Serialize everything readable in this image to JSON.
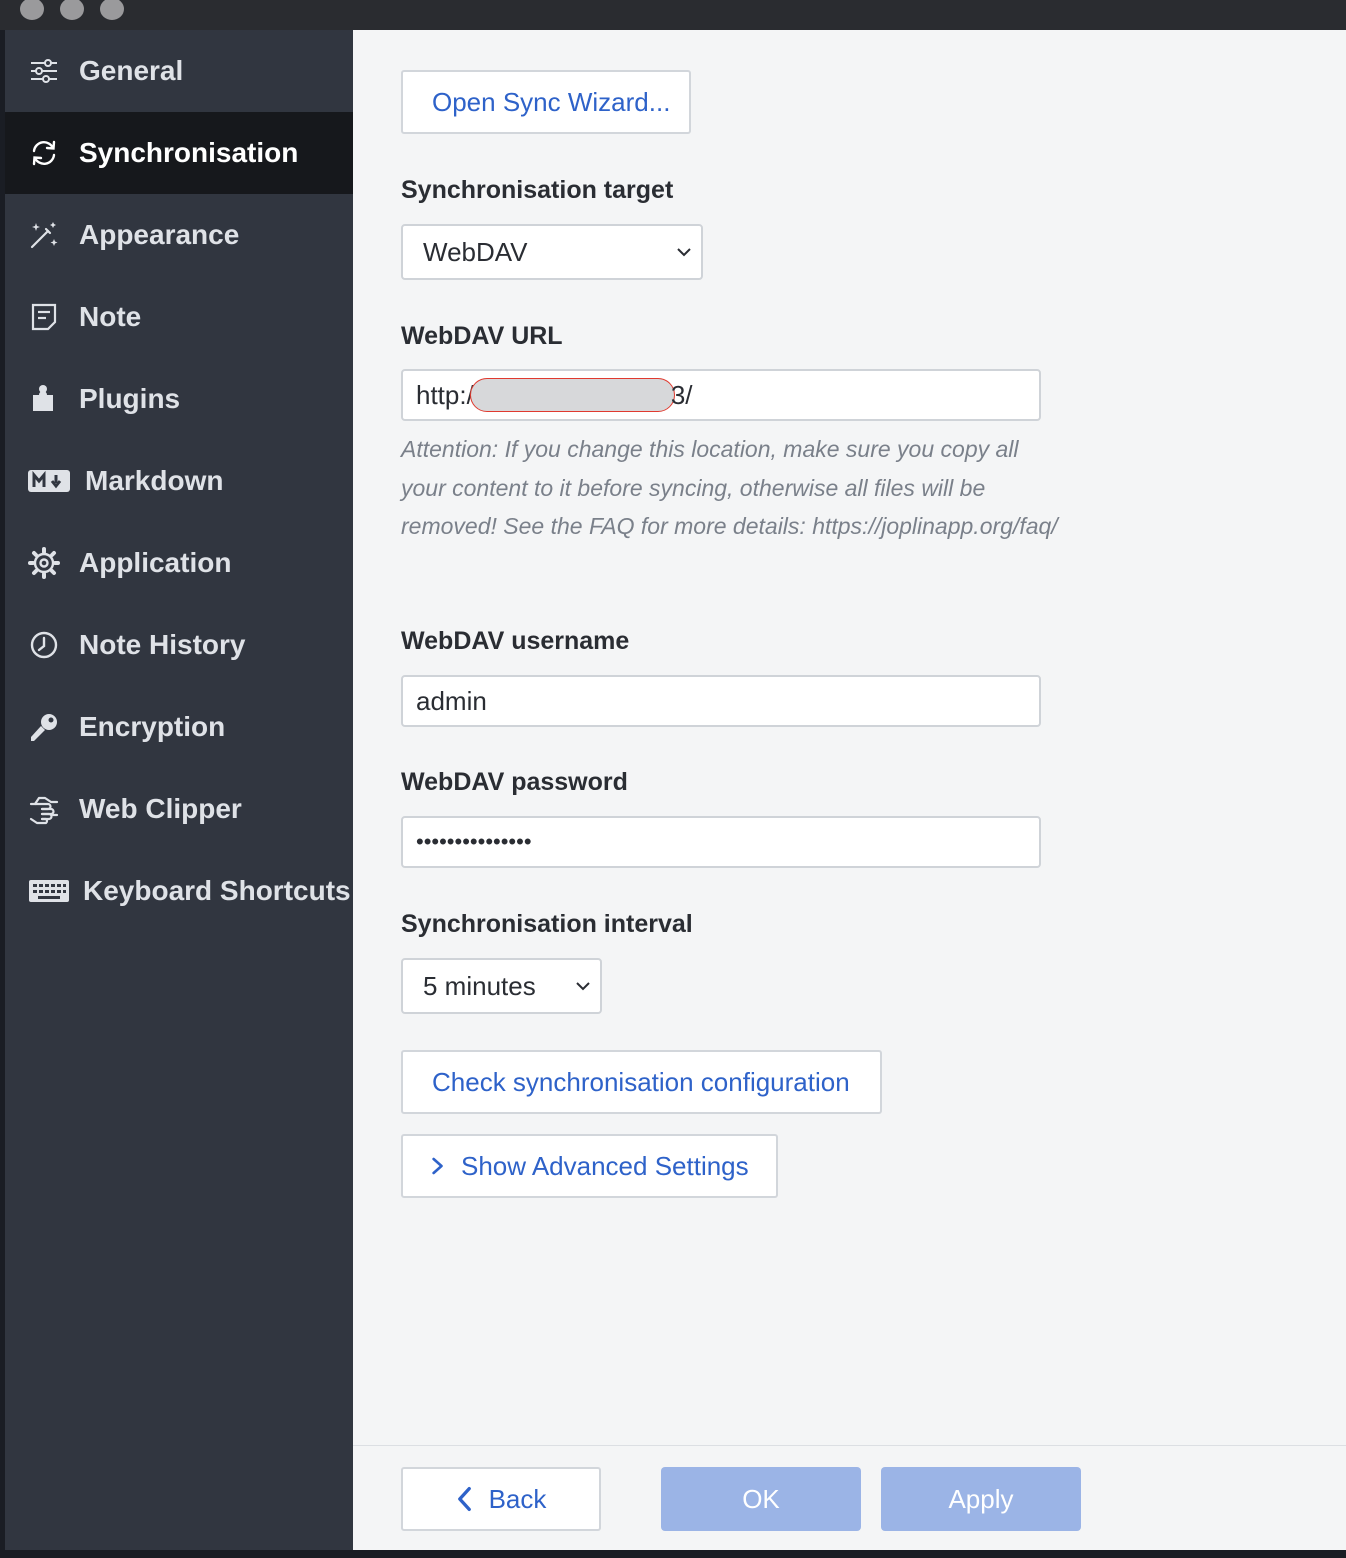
{
  "sidebar": {
    "items": [
      {
        "label": "General",
        "icon": "sliders-icon"
      },
      {
        "label": "Synchronisation",
        "icon": "sync-icon",
        "active": true
      },
      {
        "label": "Appearance",
        "icon": "magic-wand-icon"
      },
      {
        "label": "Note",
        "icon": "note-icon"
      },
      {
        "label": "Plugins",
        "icon": "puzzle-icon"
      },
      {
        "label": "Markdown",
        "icon": "markdown-icon"
      },
      {
        "label": "Application",
        "icon": "gear-icon"
      },
      {
        "label": "Note History",
        "icon": "clock-icon"
      },
      {
        "label": "Encryption",
        "icon": "key-icon"
      },
      {
        "label": "Web Clipper",
        "icon": "hand-icon"
      },
      {
        "label": "Keyboard Shortcuts",
        "icon": "keyboard-icon"
      }
    ]
  },
  "main": {
    "sync_wizard_label": "Open Sync Wizard...",
    "target_label": "Synchronisation target",
    "target_value": "WebDAV",
    "url_label": "WebDAV URL",
    "url_prefix": "http:/",
    "url_suffix": "3/",
    "url_note": "Attention: If you change this location, make sure you copy all your content to it before syncing, otherwise all files will be removed! See the FAQ for more details: https://joplinapp.org/faq/",
    "username_label": "WebDAV username",
    "username_value": "admin",
    "password_label": "WebDAV password",
    "password_value": "•••••••••••••••",
    "interval_label": "Synchronisation interval",
    "interval_value": "5 minutes",
    "check_config_label": "Check synchronisation configuration",
    "advanced_label": "Show Advanced Settings"
  },
  "footer": {
    "back_label": "Back",
    "ok_label": "OK",
    "apply_label": "Apply"
  },
  "colors": {
    "sidebar_bg": "#313640",
    "sidebar_active_bg": "#16181c",
    "accent": "#2e62c9",
    "primary_disabled": "#9bb4e6"
  }
}
